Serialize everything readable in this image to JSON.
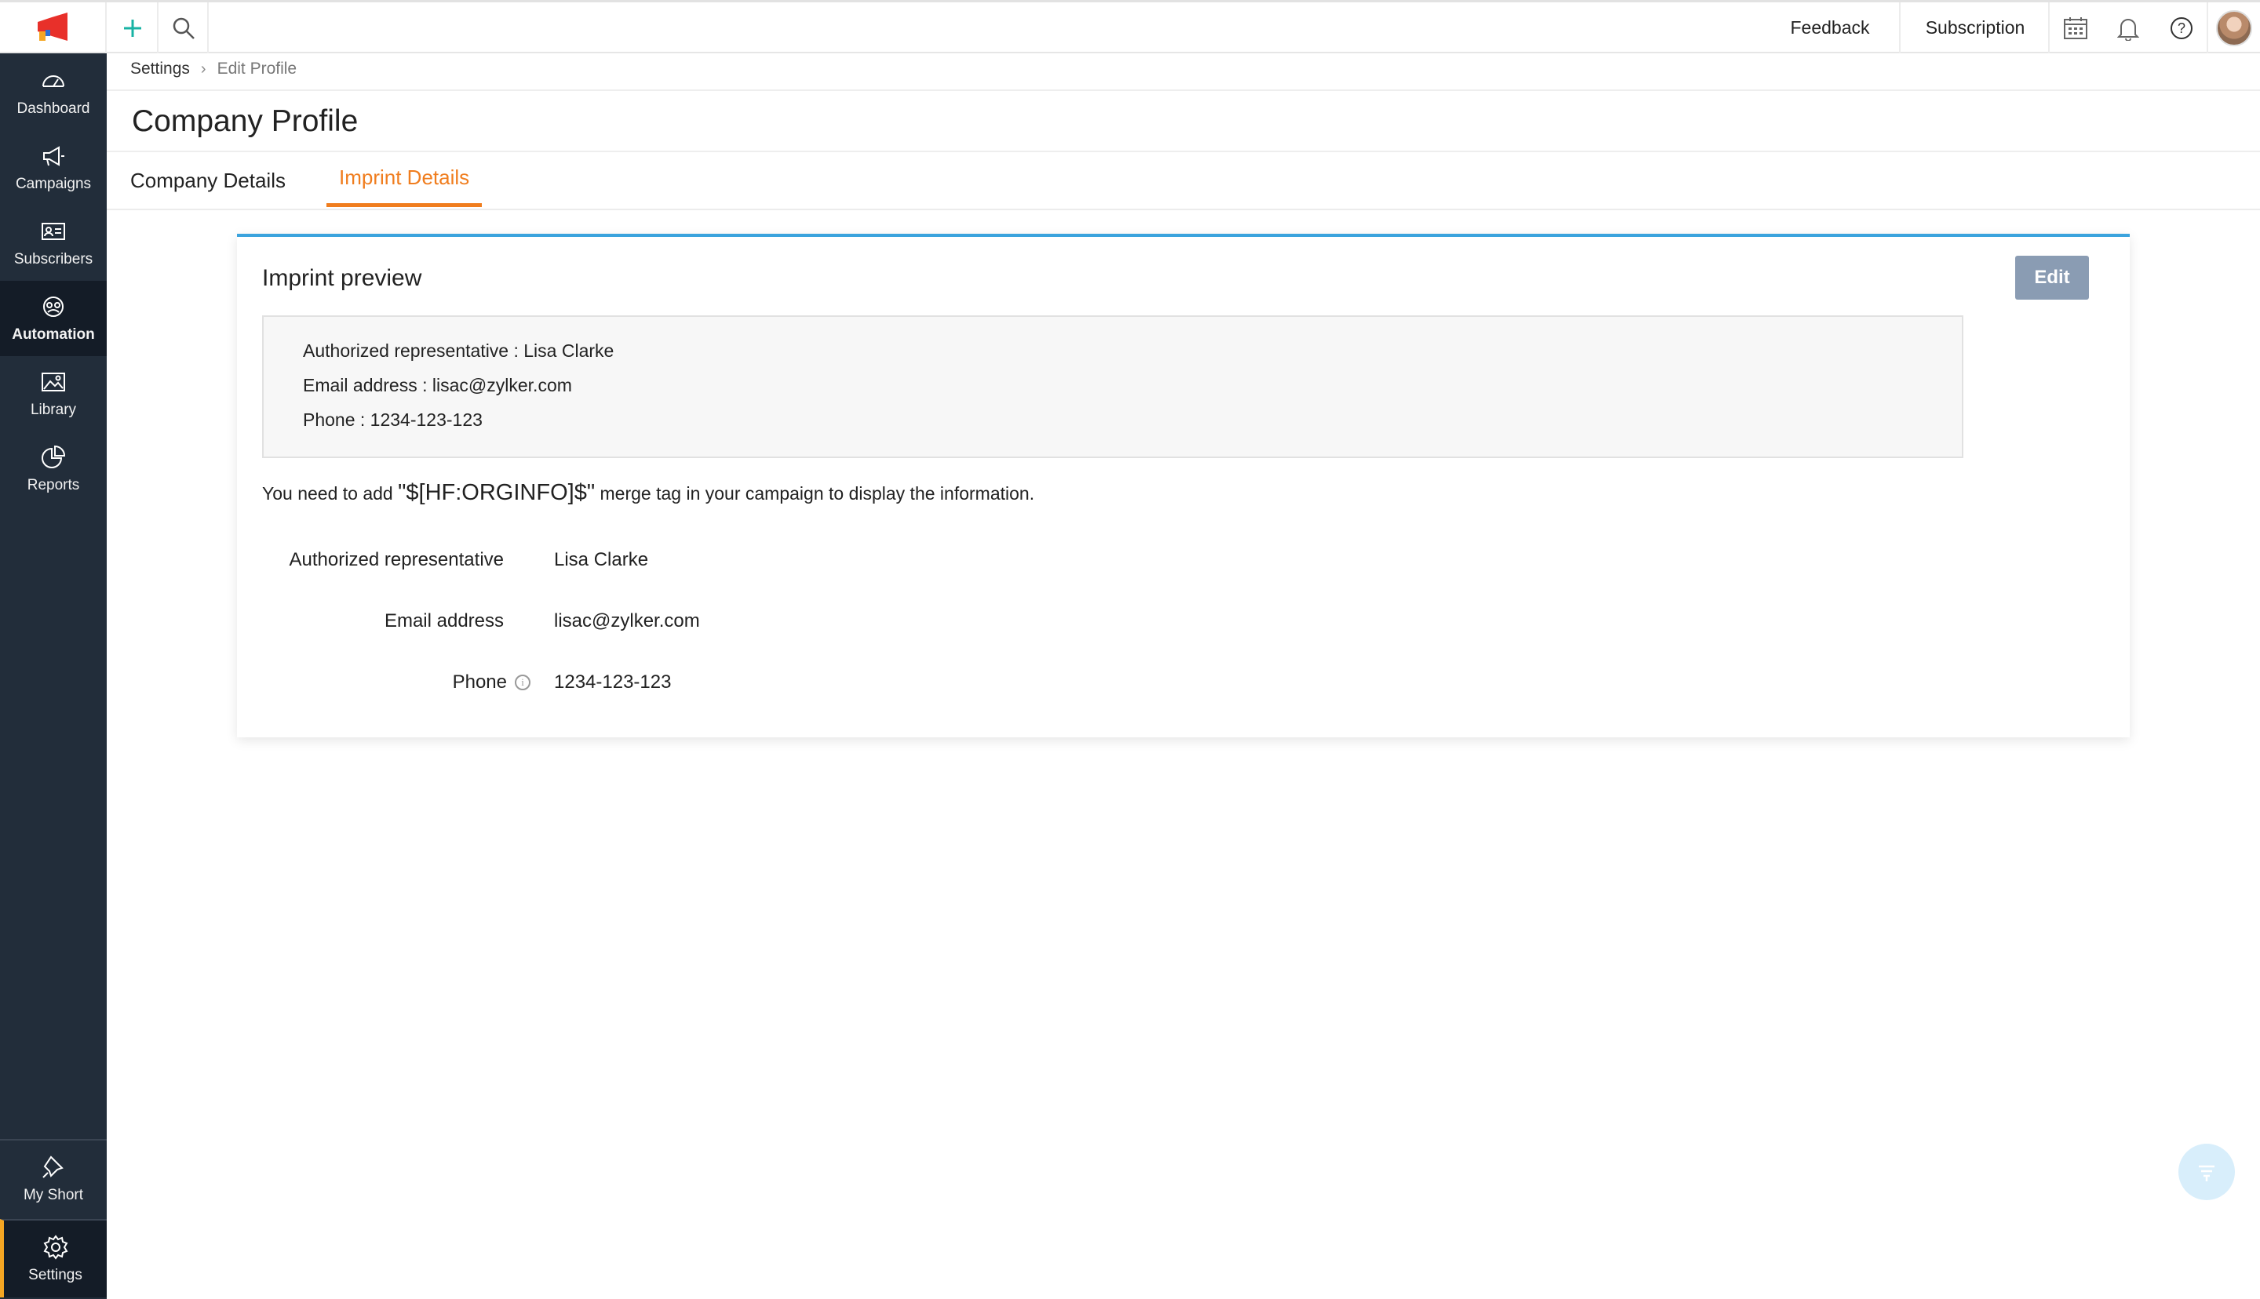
{
  "topbar": {
    "feedback_label": "Feedback",
    "subscription_label": "Subscription",
    "icons": [
      "plus-icon",
      "search-icon",
      "calendar-icon",
      "bell-icon",
      "help-icon",
      "user-avatar"
    ]
  },
  "sidebar": {
    "items": [
      {
        "label": "Dashboard",
        "icon": "dashboard-icon"
      },
      {
        "label": "Campaigns",
        "icon": "megaphone-icon"
      },
      {
        "label": "Subscribers",
        "icon": "contact-card-icon"
      },
      {
        "label": "Automation",
        "icon": "automation-icon",
        "active": true
      },
      {
        "label": "Library",
        "icon": "image-icon"
      },
      {
        "label": "Reports",
        "icon": "pie-chart-icon"
      }
    ],
    "bottom": [
      {
        "label": "My Short",
        "icon": "pin-icon"
      },
      {
        "label": "Settings",
        "icon": "gear-icon"
      }
    ]
  },
  "breadcrumb": {
    "parent": "Settings",
    "separator": "›",
    "current": "Edit Profile"
  },
  "page": {
    "title": "Company Profile",
    "tabs": [
      {
        "label": "Company Details",
        "active": false
      },
      {
        "label": "Imprint Details",
        "active": true
      }
    ]
  },
  "card": {
    "title": "Imprint preview",
    "edit_label": "Edit",
    "preview_lines": [
      "Authorized representative : Lisa Clarke",
      "Email address : lisac@zylker.com",
      "Phone : 1234-123-123"
    ],
    "note_prefix": "You need to add ",
    "note_tag": "\"$[HF:ORGINFO]$\"",
    "note_suffix": " merge tag in your campaign to display the information.",
    "fields": [
      {
        "label": "Authorized representative",
        "value": "Lisa Clarke"
      },
      {
        "label": "Email address",
        "value": "lisac@zylker.com"
      },
      {
        "label": "Phone",
        "value": "1234-123-123",
        "info": true
      }
    ]
  },
  "colors": {
    "sidebar_bg": "#222d3a",
    "accent_orange": "#f07d1e",
    "card_border_blue": "#3ba3dd",
    "edit_button": "#8a9cb3"
  }
}
